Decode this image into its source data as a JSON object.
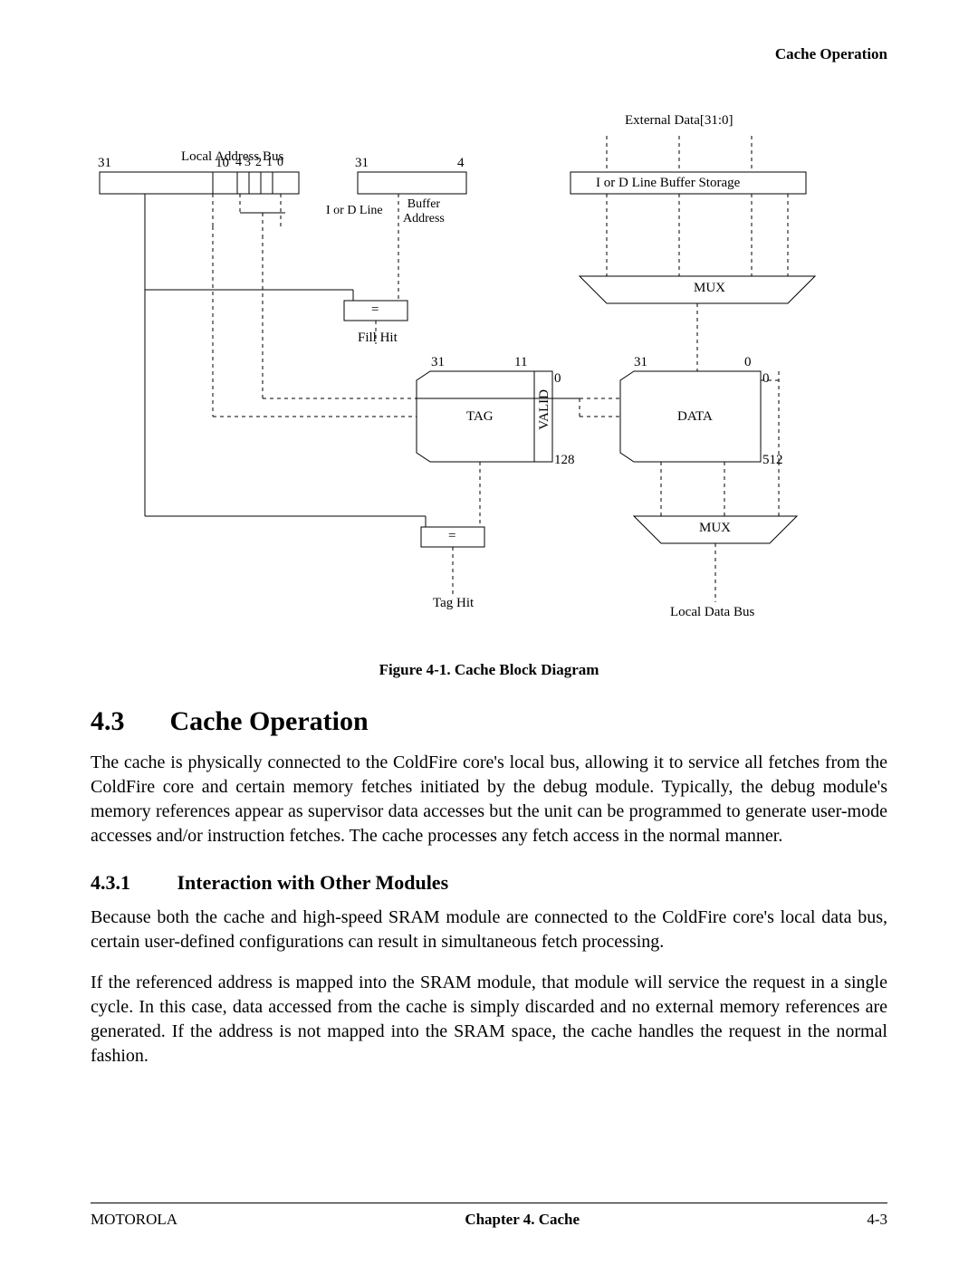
{
  "running_head": "Cache Operation",
  "diagram": {
    "external_data": "External Data[31:0]",
    "local_addr_bus": "Local Address Bus",
    "bits": {
      "a31": "31",
      "a10": "10",
      "a4": "4",
      "a3": "3",
      "a2": "2",
      "a1": "1",
      "a0": "0",
      "b31": "31",
      "b4": "4",
      "c31": "31",
      "c11": "11",
      "c0": "0",
      "d31": "31",
      "d0_top": "0",
      "d0_side": "0",
      "tag128": "128",
      "data512": "512"
    },
    "line_buffer": "I or D Line Buffer Storage",
    "i_or_d_line": "I or D Line",
    "buffer_address": "Buffer\nAddress",
    "eq": "=",
    "fill_hit": "Fill Hit",
    "tag": "TAG",
    "valid": "VALID",
    "data": "DATA",
    "mux": "MUX",
    "tag_hit": "Tag Hit",
    "local_data_bus": "Local Data Bus"
  },
  "figure_caption": "Figure 4-1. Cache Block Diagram",
  "section": {
    "num": "4.3",
    "title": "Cache Operation"
  },
  "para1": "The cache is physically connected to the ColdFire core's local bus, allowing it to service all fetches from the ColdFire core and certain memory fetches initiated by the debug module. Typically, the debug module's memory references appear as supervisor data accesses but the unit can be programmed to generate user-mode accesses and/or instruction fetches. The cache processes any fetch access in the normal manner.",
  "subsection": {
    "num": "4.3.1",
    "title": "Interaction with Other Modules"
  },
  "para2": "Because both the cache and high-speed SRAM module are connected to the ColdFire core's local data bus, certain user-defined configurations can result in simultaneous fetch processing.",
  "para3": "If the referenced address is mapped into the SRAM module, that module will service the request in a single cycle. In this case, data accessed from the cache is simply discarded and no external memory references are generated. If the address is not mapped into the SRAM space, the cache handles the request in the normal fashion.",
  "footer": {
    "left": "MOTOROLA",
    "center": "Chapter 4. Cache",
    "right": "4-3"
  }
}
